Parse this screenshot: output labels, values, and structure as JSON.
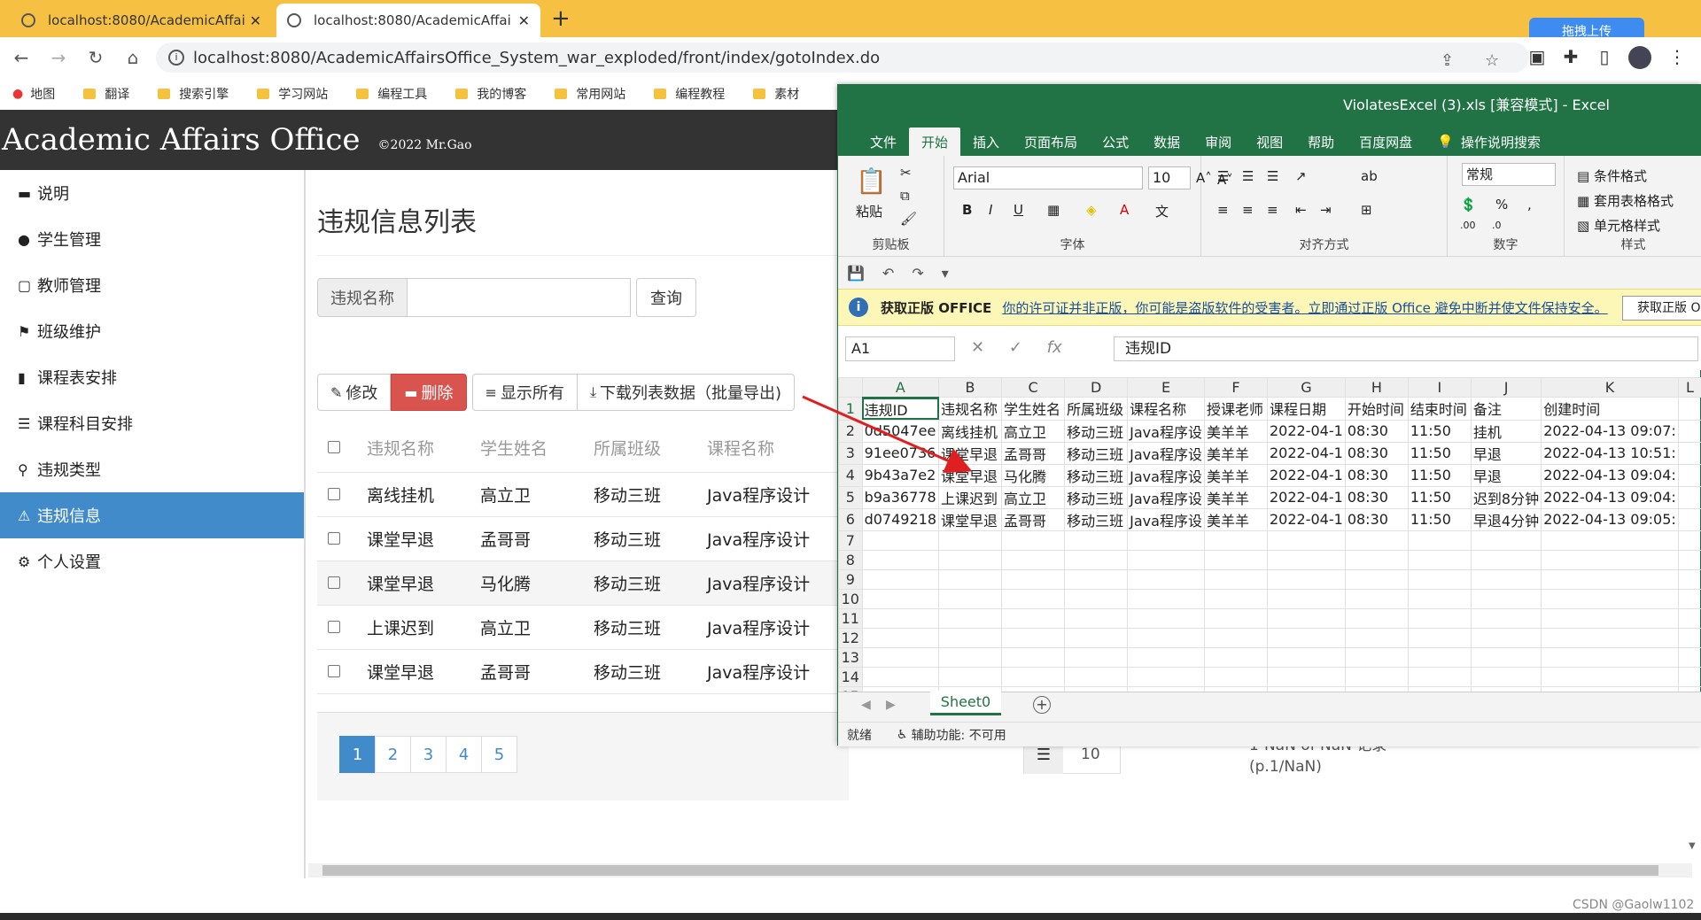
{
  "browser": {
    "tabs": [
      {
        "title": "localhost:8080/AcademicAffai"
      },
      {
        "title": "localhost:8080/AcademicAffai"
      }
    ],
    "address": "localhost:8080/AcademicAffairsOffice_System_war_exploded/front/index/gotoIndex.do",
    "upload_label": "拖拽上传",
    "bookmarks": [
      "地图",
      "翻译",
      "搜索引擎",
      "学习网站",
      "编程工具",
      "我的博客",
      "常用网站",
      "编程教程",
      "素材"
    ]
  },
  "app": {
    "title": "Academic Affairs Office",
    "copyright": "©2022 Mr.Gao"
  },
  "sidebar": {
    "items": [
      {
        "label": "说明",
        "icon": "comment-icon"
      },
      {
        "label": "学生管理",
        "icon": "user-icon"
      },
      {
        "label": "教师管理",
        "icon": "square-icon"
      },
      {
        "label": "班级维护",
        "icon": "flag-icon"
      },
      {
        "label": "课程表安排",
        "icon": "book-icon"
      },
      {
        "label": "课程科目安排",
        "icon": "list-icon"
      },
      {
        "label": "违规类型",
        "icon": "search-icon"
      },
      {
        "label": "违规信息",
        "icon": "warning-icon",
        "active": true
      },
      {
        "label": "个人设置",
        "icon": "gear-icon"
      }
    ]
  },
  "main": {
    "title": "违规信息列表",
    "search_label": "违规名称",
    "search_value": "",
    "search_button": "查询",
    "toolbar": {
      "edit": "修改",
      "delete": "删除",
      "show_all": "显示所有",
      "download": "下载列表数据（批量导出)"
    },
    "columns": [
      "违规名称",
      "学生姓名",
      "所属班级",
      "课程名称"
    ],
    "rows": [
      [
        "离线挂机",
        "高立卫",
        "移动三班",
        "Java程序设计"
      ],
      [
        "课堂早退",
        "孟哥哥",
        "移动三班",
        "Java程序设计"
      ],
      [
        "课堂早退",
        "马化腾",
        "移动三班",
        "Java程序设计"
      ],
      [
        "上课迟到",
        "高立卫",
        "移动三班",
        "Java程序设计"
      ],
      [
        "课堂早退",
        "孟哥哥",
        "移动三班",
        "Java程序设计"
      ]
    ],
    "pages": [
      "1",
      "2",
      "3",
      "4",
      "5"
    ],
    "page_size": "10",
    "records_line1": "1-NaN of NaN 记录",
    "records_line2": "(p.1/NaN)"
  },
  "excel": {
    "title": "ViolatesExcel (3).xls  [兼容模式]  -  Excel",
    "tabs": [
      "文件",
      "开始",
      "插入",
      "页面布局",
      "公式",
      "数据",
      "审阅",
      "视图",
      "帮助",
      "百度网盘",
      "操作说明搜索"
    ],
    "ribbon": {
      "paste": "粘贴",
      "clipboard": "剪贴板",
      "font_name": "Arial",
      "font_size": "10",
      "font_group": "字体",
      "align_group": "对齐方式",
      "number_format": "常规",
      "number_group": "数字",
      "cond_format": "条件格式",
      "table_format": "套用表格格式",
      "cell_style": "单元格样式",
      "style_group": "样式"
    },
    "notice": {
      "title": "获取正版 OFFICE",
      "message": "你的许可证并非正版，你可能是盗版软件的受害者。立即通过正版 Office 避免中断并使文件保持安全。",
      "button": "获取正版 O"
    },
    "name_box": "A1",
    "formula": "违规ID",
    "col_headers": [
      "A",
      "B",
      "C",
      "D",
      "E",
      "F",
      "G",
      "H",
      "I",
      "J",
      "K",
      "L"
    ],
    "rows": [
      [
        "违规ID",
        "违规名称",
        "学生姓名",
        "所属班级",
        "课程名称",
        "授课老师",
        "课程日期",
        "开始时间",
        "结束时间",
        "备注",
        "创建时间",
        ""
      ],
      [
        "0d5047ee",
        "离线挂机",
        "高立卫",
        "移动三班",
        "Java程序设",
        "美羊羊",
        "2022-04-1",
        "08:30",
        "11:50",
        "挂机",
        "2022-04-13 09:07:",
        ""
      ],
      [
        "91ee0736",
        "课堂早退",
        "孟哥哥",
        "移动三班",
        "Java程序设",
        "美羊羊",
        "2022-04-1",
        "08:30",
        "11:50",
        "早退",
        "2022-04-13 10:51:",
        ""
      ],
      [
        "9b43a7e2",
        "课堂早退",
        "马化腾",
        "移动三班",
        "Java程序设",
        "美羊羊",
        "2022-04-1",
        "08:30",
        "11:50",
        "早退",
        "2022-04-13 09:04:",
        ""
      ],
      [
        "b9a36778",
        "上课迟到",
        "高立卫",
        "移动三班",
        "Java程序设",
        "美羊羊",
        "2022-04-1",
        "08:30",
        "11:50",
        "迟到8分钟",
        "2022-04-13 09:04:",
        ""
      ],
      [
        "d0749218",
        "课堂早退",
        "孟哥哥",
        "移动三班",
        "Java程序设",
        "美羊羊",
        "2022-04-1",
        "08:30",
        "11:50",
        "早退4分钟",
        "2022-04-13 09:05:",
        ""
      ],
      [
        "",
        "",
        "",
        "",
        "",
        "",
        "",
        "",
        "",
        "",
        "",
        ""
      ],
      [
        "",
        "",
        "",
        "",
        "",
        "",
        "",
        "",
        "",
        "",
        "",
        ""
      ],
      [
        "",
        "",
        "",
        "",
        "",
        "",
        "",
        "",
        "",
        "",
        "",
        ""
      ],
      [
        "",
        "",
        "",
        "",
        "",
        "",
        "",
        "",
        "",
        "",
        "",
        ""
      ],
      [
        "",
        "",
        "",
        "",
        "",
        "",
        "",
        "",
        "",
        "",
        "",
        ""
      ],
      [
        "",
        "",
        "",
        "",
        "",
        "",
        "",
        "",
        "",
        "",
        "",
        ""
      ],
      [
        "",
        "",
        "",
        "",
        "",
        "",
        "",
        "",
        "",
        "",
        "",
        ""
      ],
      [
        "",
        "",
        "",
        "",
        "",
        "",
        "",
        "",
        "",
        "",
        "",
        ""
      ],
      [
        "",
        "",
        "",
        "",
        "",
        "",
        "",
        "",
        "",
        "",
        "",
        ""
      ]
    ],
    "sheet_tab": "Sheet0",
    "status_ready": "就绪",
    "status_accessibility": "辅助功能: 不可用"
  },
  "watermark": "CSDN @Gaolw1102"
}
